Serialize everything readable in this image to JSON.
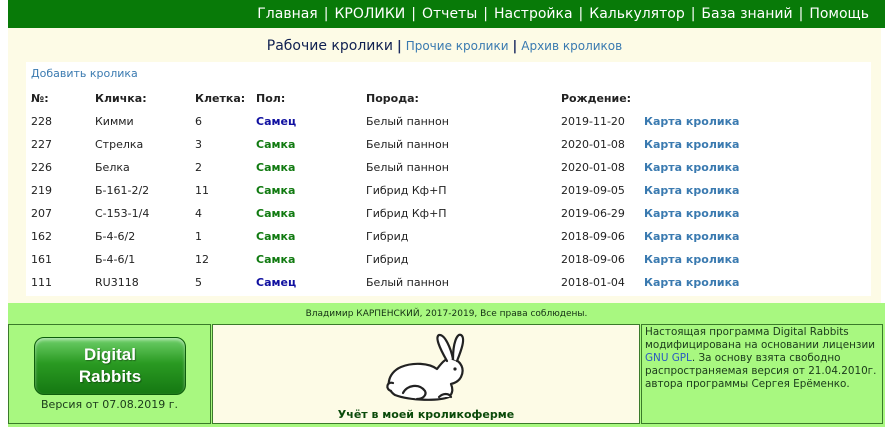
{
  "nav": {
    "items": [
      "Главная",
      "КРОЛИКИ",
      "Отчеты",
      "Настройка",
      "Калькулятор",
      "База знаний",
      "Помощь"
    ],
    "separator": "|"
  },
  "subtabs": {
    "active": "Рабочие кролики",
    "other": [
      "Прочие кролики",
      "Архив кроликов"
    ]
  },
  "list": {
    "add_link": "Добавить кролика",
    "headers": [
      "№:",
      "Кличка:",
      "Клетка:",
      "Пол:",
      "Порода:",
      "Рождение:"
    ],
    "card_label": "Карта кролика",
    "rows": [
      {
        "num": "228",
        "name": "Кимми",
        "cage": "6",
        "sex": "Самец",
        "sex_type": "m",
        "breed": "Белый паннон",
        "birth": "2019-11-20"
      },
      {
        "num": "227",
        "name": "Стрелка",
        "cage": "3",
        "sex": "Самка",
        "sex_type": "f",
        "breed": "Белый паннон",
        "birth": "2020-01-08"
      },
      {
        "num": "226",
        "name": "Белка",
        "cage": "2",
        "sex": "Самка",
        "sex_type": "f",
        "breed": "Белый паннон",
        "birth": "2020-01-08"
      },
      {
        "num": "219",
        "name": "Б-161-2/2",
        "cage": "11",
        "sex": "Самка",
        "sex_type": "f",
        "breed": "Гибрид Кф+П",
        "birth": "2019-09-05"
      },
      {
        "num": "207",
        "name": "С-153-1/4",
        "cage": "4",
        "sex": "Самка",
        "sex_type": "f",
        "breed": "Гибрид Кф+П",
        "birth": "2019-06-29"
      },
      {
        "num": "162",
        "name": "Б-4-6/2",
        "cage": "1",
        "sex": "Самка",
        "sex_type": "f",
        "breed": "Гибрид",
        "birth": "2018-09-06"
      },
      {
        "num": "161",
        "name": "Б-4-6/1",
        "cage": "12",
        "sex": "Самка",
        "sex_type": "f",
        "breed": "Гибрид",
        "birth": "2018-09-06"
      },
      {
        "num": "111",
        "name": "RU3118",
        "cage": "5",
        "sex": "Самец",
        "sex_type": "m",
        "breed": "Белый паннон",
        "birth": "2018-01-04"
      }
    ]
  },
  "footer": {
    "copyright": "Владимир КАРПЕНСКИЙ, 2017-2019, Все права соблюдены.",
    "logo_line1": "Digital",
    "logo_line2": "Rabbits",
    "version": "Версия от 07.08.2019 г.",
    "tagline": "Учёт в моей кроликоферме",
    "info_part1": "Настоящая программа Digital Rabbits модифицирована на основании лицензии ",
    "info_gpl": "GNU GPL",
    "info_part2": ". За основу взята свободно распространяемая версия от 21.04.2010г. автора программы Сергея Ерёменко."
  },
  "icons": {
    "rabbit": "rabbit-icon"
  },
  "colors": {
    "nav_bg": "#087a08",
    "main_bg": "#fdfbe6",
    "footer_bg": "#a8f880",
    "link": "#3a7ab0",
    "male": "#1010a0",
    "female": "#107a10"
  }
}
